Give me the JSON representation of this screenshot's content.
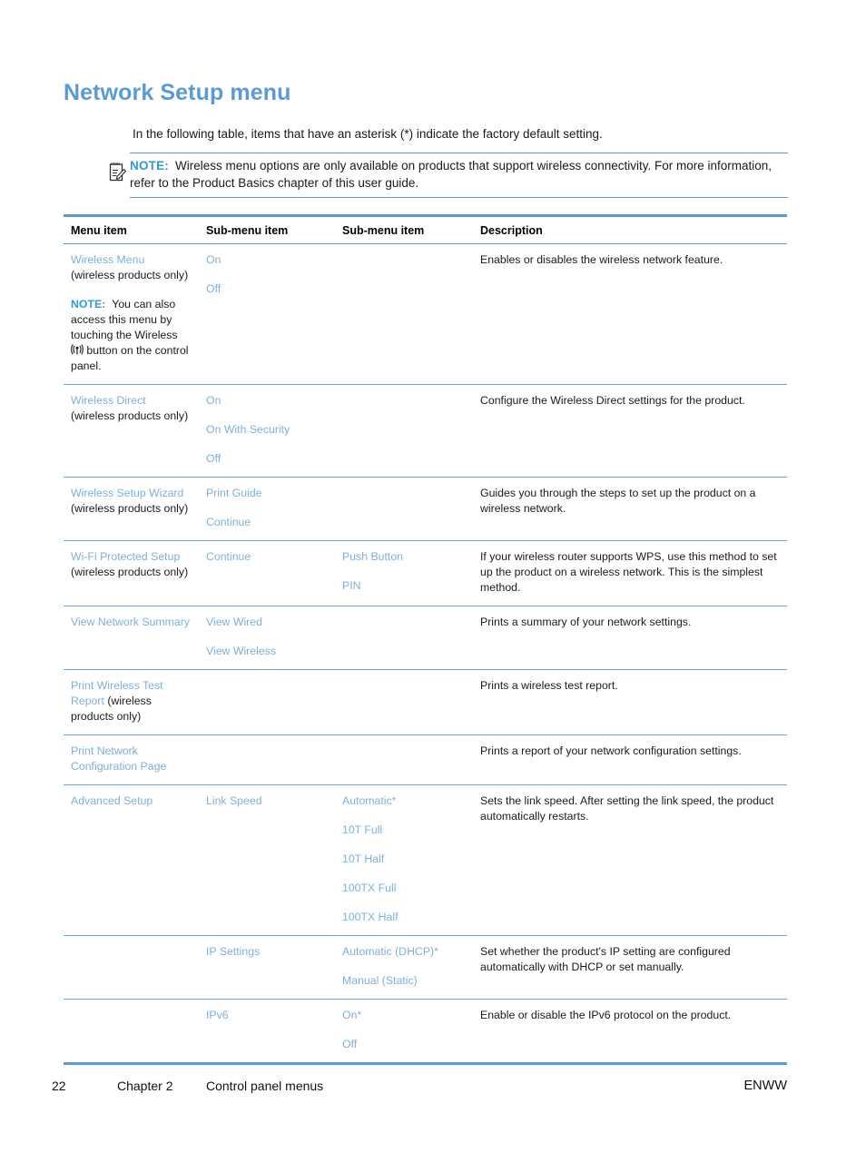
{
  "heading": "Network Setup menu",
  "intro": "In the following table, items that have an asterisk (*) indicate the factory default setting.",
  "note": {
    "icon": "note-clipboard-icon",
    "label": "NOTE:",
    "text": "Wireless menu options are only available on products that support wireless connectivity. For more information, refer to the Product Basics chapter of this user guide."
  },
  "table": {
    "headers": {
      "menu_item": "Menu item",
      "sub_menu_item_1": "Sub-menu item",
      "sub_menu_item_2": "Sub-menu item",
      "description": "Description"
    },
    "rows": [
      {
        "menu_item_link": "Wireless Menu",
        "menu_item_plain": " (wireless products only)",
        "cell_note_label": "NOTE:",
        "cell_note_text_before": "You can also access this menu by touching the Wireless",
        "cell_note_icon": "wireless-signal-icon",
        "cell_note_text_after": "button on the control panel.",
        "sub1": [
          "On",
          "Off"
        ],
        "sub2": [],
        "description": "Enables or disables the wireless network feature."
      },
      {
        "menu_item_link": "Wireless Direct",
        "menu_item_plain": " (wireless products only)",
        "sub1": [
          "On",
          "On With Security",
          "Off"
        ],
        "sub2": [],
        "description": "Configure the Wireless Direct settings for the product."
      },
      {
        "menu_item_link": "Wireless Setup Wizard",
        "menu_item_plain": " (wireless products only)",
        "sub1": [
          "Print Guide",
          "Continue"
        ],
        "sub2": [],
        "description": "Guides you through the steps to set up the product on a wireless network."
      },
      {
        "menu_item_link": "Wi-Fi Protected Setup",
        "menu_item_plain": " (wireless products only)",
        "sub1": [
          "Continue"
        ],
        "sub2": [
          "Push Button",
          "PIN"
        ],
        "description": "If your wireless router supports WPS, use this method to set up the product on a wireless network. This is the simplest method."
      },
      {
        "menu_item_link": "View Network Summary",
        "menu_item_plain": "",
        "sub1": [
          "View Wired",
          "View Wireless"
        ],
        "sub2": [],
        "description": "Prints a summary of your network settings."
      },
      {
        "menu_item_link": "Print Wireless Test Report",
        "menu_item_plain": " (wireless products only)",
        "sub1": [],
        "sub2": [],
        "description": "Prints a wireless test report."
      },
      {
        "menu_item_link": "Print Network Configuration Page",
        "menu_item_plain": "",
        "sub1": [],
        "sub2": [],
        "description": "Prints a report of your network configuration settings."
      },
      {
        "menu_item_link": "Advanced Setup",
        "menu_item_plain": "",
        "sub1": [
          "Link Speed"
        ],
        "sub2": [
          "Automatic*",
          "10T Full",
          "10T Half",
          "100TX Full",
          "100TX Half"
        ],
        "description": "Sets the link speed. After setting the link speed, the product automatically restarts."
      },
      {
        "menu_item_link": "",
        "menu_item_plain": "",
        "sub1": [
          "IP Settings"
        ],
        "sub2": [
          "Automatic (DHCP)*",
          "Manual (Static)"
        ],
        "description": "Set whether the product's IP setting are configured automatically with DHCP or set manually."
      },
      {
        "menu_item_link": "",
        "menu_item_plain": "",
        "sub1": [
          "IPv6"
        ],
        "sub2": [
          "On*",
          "Off"
        ],
        "description": "Enable or disable the IPv6 protocol on the product."
      }
    ]
  },
  "footer": {
    "page_number": "22",
    "chapter": "Chapter 2",
    "chapter_title": "Control panel menus",
    "locale": "ENWW"
  },
  "colors": {
    "heading_blue": "#5B9BD5",
    "link_blue": "#7CB0DC",
    "note_blue": "#2E9BD6",
    "rule_blue": "#6CA6D9"
  }
}
